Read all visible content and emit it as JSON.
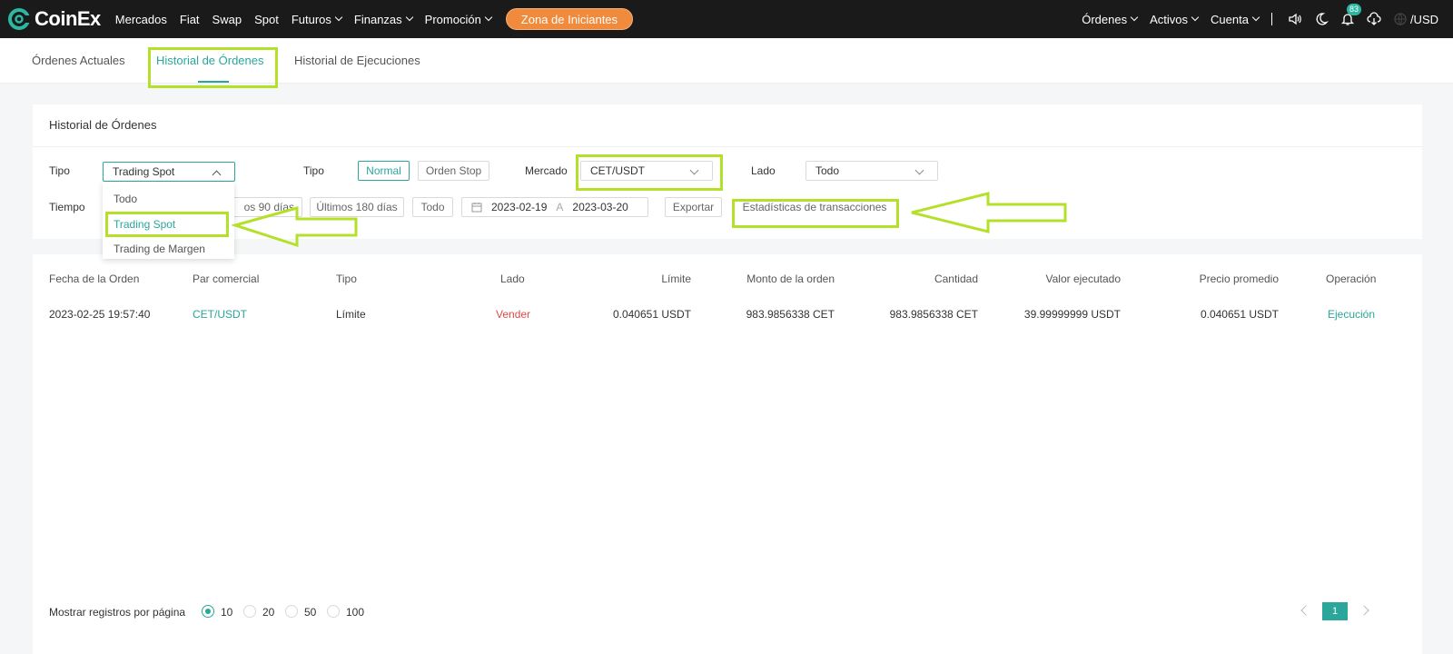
{
  "brand": {
    "name": "CoinEx",
    "accent": "#2aa79a",
    "promo_color": "#f08a3c"
  },
  "nav": {
    "items": [
      "Mercados",
      "Fiat",
      "Swap",
      "Spot",
      "Futuros",
      "Finanzas",
      "Promoción"
    ],
    "promo_button": "Zona de Iniciantes",
    "right_items": [
      "Órdenes",
      "Activos",
      "Cuenta"
    ],
    "notifications_count": "83",
    "currency": "/USD"
  },
  "tabs": [
    "Órdenes Actuales",
    "Historial de Órdenes",
    "Historial de Ejecuciones"
  ],
  "filters": {
    "title": "Historial de Órdenes",
    "tipo_label": "Tipo",
    "tipo_value": "Trading Spot",
    "tipo_options": [
      "Todo",
      "Trading Spot",
      "Trading de Margen"
    ],
    "tipo2_label": "Tipo",
    "tipo2_options": [
      "Normal",
      "Orden Stop"
    ],
    "mercado_label": "Mercado",
    "mercado_value": "CET/USDT",
    "lado_label": "Lado",
    "lado_value": "Todo",
    "tiempo_label": "Tiempo",
    "tiempo_partial": "os 90 días",
    "tiempo_options": [
      "Últimos 180 días",
      "Todo"
    ],
    "date_from": "2023-02-19",
    "date_sep": "A",
    "date_to": "2023-03-20",
    "export_button": "Exportar",
    "stats_button": "Estadísticas de transacciones"
  },
  "table": {
    "headers": [
      "Fecha de la Orden",
      "Par comercial",
      "Tipo",
      "Lado",
      "Límite",
      "Monto de la orden",
      "Cantidad",
      "Valor ejecutado",
      "Precio promedio",
      "Operación"
    ],
    "rows": [
      [
        "2023-02-25 19:57:40",
        "CET/USDT",
        "Límite",
        "Vender",
        "0.040651 USDT",
        "983.9856338 CET",
        "983.9856338 CET",
        "39.99999999 USDT",
        "0.040651 USDT",
        "Ejecución"
      ]
    ]
  },
  "pagination": {
    "label": "Mostrar registros por página",
    "options": [
      "10",
      "20",
      "50",
      "100"
    ],
    "selected": "10",
    "current_page": "1"
  }
}
